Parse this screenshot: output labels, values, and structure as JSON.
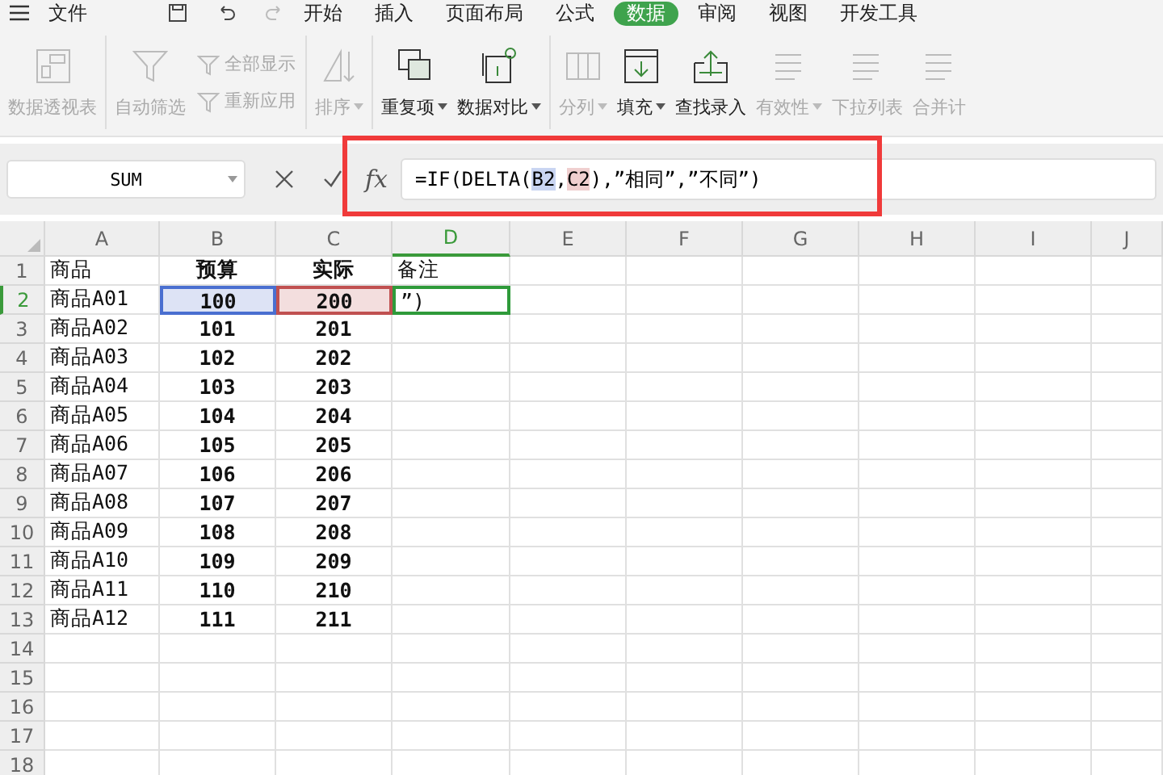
{
  "menu": {
    "file": "文件",
    "tabs": [
      {
        "label": "开始",
        "selected": false
      },
      {
        "label": "插入",
        "selected": false
      },
      {
        "label": "页面布局",
        "selected": false
      },
      {
        "label": "公式",
        "selected": false
      },
      {
        "label": "数据",
        "selected": true
      },
      {
        "label": "审阅",
        "selected": false
      },
      {
        "label": "视图",
        "selected": false
      },
      {
        "label": "开发工具",
        "selected": false
      }
    ]
  },
  "ribbon": {
    "groups": [
      [
        {
          "kind": "large",
          "label": "数据透视表",
          "disabled": true,
          "has_menu": false
        }
      ],
      [
        {
          "kind": "large",
          "label": "自动筛选",
          "disabled": true,
          "has_menu": false
        },
        {
          "kind": "stack",
          "items": [
            {
              "label": "全部显示",
              "disabled": true
            },
            {
              "label": "重新应用",
              "disabled": true
            }
          ]
        }
      ],
      [
        {
          "kind": "large",
          "label": "排序",
          "disabled": true,
          "has_menu": true
        }
      ],
      [
        {
          "kind": "large",
          "label": "重复项",
          "disabled": false,
          "has_menu": true
        },
        {
          "kind": "large",
          "label": "数据对比",
          "disabled": false,
          "has_menu": true
        }
      ],
      [
        {
          "kind": "large",
          "label": "分列",
          "disabled": true,
          "has_menu": true
        },
        {
          "kind": "large",
          "label": "填充",
          "disabled": false,
          "has_menu": true
        },
        {
          "kind": "large",
          "label": "查找录入",
          "disabled": false,
          "has_menu": false
        },
        {
          "kind": "large",
          "label": "有效性",
          "disabled": true,
          "has_menu": true
        },
        {
          "kind": "large",
          "label": "下拉列表",
          "disabled": true,
          "has_menu": false
        },
        {
          "kind": "large",
          "label": "合并计",
          "disabled": true,
          "has_menu": false
        }
      ]
    ]
  },
  "formula_bar": {
    "name_box": "SUM",
    "fx_label": "fx",
    "formula": [
      {
        "text": "=IF(DELTA("
      },
      {
        "text": "B2",
        "color": "#c9d5f2"
      },
      {
        "text": ","
      },
      {
        "text": "C2",
        "color": "#f0cfcf"
      },
      {
        "text": "),”相同”,”不同”)"
      }
    ],
    "highlighted": true
  },
  "sheet": {
    "columns": [
      {
        "label": "A",
        "selected": false
      },
      {
        "label": "B",
        "selected": false
      },
      {
        "label": "C",
        "selected": false
      },
      {
        "label": "D",
        "selected": true
      },
      {
        "label": "E",
        "selected": false
      },
      {
        "label": "F",
        "selected": false
      },
      {
        "label": "G",
        "selected": false
      },
      {
        "label": "H",
        "selected": false
      },
      {
        "label": "I",
        "selected": false
      },
      {
        "label": "J",
        "selected": false
      }
    ],
    "rows": [
      {
        "number": "1",
        "selected": false,
        "cells": [
          {
            "text": "商品",
            "bold": false,
            "centered": false,
            "active": false
          },
          {
            "text": "预算",
            "bold": true,
            "centered": true,
            "active": false
          },
          {
            "text": "实际",
            "bold": true,
            "centered": true,
            "active": false
          },
          {
            "text": "备注",
            "bold": false,
            "centered": false,
            "active": false
          }
        ]
      },
      {
        "number": "2",
        "selected": true,
        "cells": [
          {
            "text": "商品A01",
            "bold": false,
            "centered": false,
            "active": false
          },
          {
            "text": "100",
            "bold": true,
            "centered": true,
            "active": false,
            "color": "#dde3f5"
          },
          {
            "text": "200",
            "bold": true,
            "centered": true,
            "active": false,
            "color": "#f3dede"
          },
          {
            "text": "”)",
            "bold": false,
            "centered": false,
            "active": true
          }
        ]
      },
      {
        "number": "3",
        "selected": false,
        "cells": [
          {
            "text": "商品A02",
            "bold": false,
            "centered": false,
            "active": false
          },
          {
            "text": "101",
            "bold": true,
            "centered": true,
            "active": false
          },
          {
            "text": "201",
            "bold": true,
            "centered": true,
            "active": false
          }
        ]
      },
      {
        "number": "4",
        "selected": false,
        "cells": [
          {
            "text": "商品A03",
            "bold": false,
            "centered": false,
            "active": false
          },
          {
            "text": "102",
            "bold": true,
            "centered": true,
            "active": false
          },
          {
            "text": "202",
            "bold": true,
            "centered": true,
            "active": false
          }
        ]
      },
      {
        "number": "5",
        "selected": false,
        "cells": [
          {
            "text": "商品A04",
            "bold": false,
            "centered": false,
            "active": false
          },
          {
            "text": "103",
            "bold": true,
            "centered": true,
            "active": false
          },
          {
            "text": "203",
            "bold": true,
            "centered": true,
            "active": false
          }
        ]
      },
      {
        "number": "6",
        "selected": false,
        "cells": [
          {
            "text": "商品A05",
            "bold": false,
            "centered": false,
            "active": false
          },
          {
            "text": "104",
            "bold": true,
            "centered": true,
            "active": false
          },
          {
            "text": "204",
            "bold": true,
            "centered": true,
            "active": false
          }
        ]
      },
      {
        "number": "7",
        "selected": false,
        "cells": [
          {
            "text": "商品A06",
            "bold": false,
            "centered": false,
            "active": false
          },
          {
            "text": "105",
            "bold": true,
            "centered": true,
            "active": false
          },
          {
            "text": "205",
            "bold": true,
            "centered": true,
            "active": false
          }
        ]
      },
      {
        "number": "8",
        "selected": false,
        "cells": [
          {
            "text": "商品A07",
            "bold": false,
            "centered": false,
            "active": false
          },
          {
            "text": "106",
            "bold": true,
            "centered": true,
            "active": false
          },
          {
            "text": "206",
            "bold": true,
            "centered": true,
            "active": false
          }
        ]
      },
      {
        "number": "9",
        "selected": false,
        "cells": [
          {
            "text": "商品A08",
            "bold": false,
            "centered": false,
            "active": false
          },
          {
            "text": "107",
            "bold": true,
            "centered": true,
            "active": false
          },
          {
            "text": "207",
            "bold": true,
            "centered": true,
            "active": false
          }
        ]
      },
      {
        "number": "10",
        "selected": false,
        "cells": [
          {
            "text": "商品A09",
            "bold": false,
            "centered": false,
            "active": false
          },
          {
            "text": "108",
            "bold": true,
            "centered": true,
            "active": false
          },
          {
            "text": "208",
            "bold": true,
            "centered": true,
            "active": false
          }
        ]
      },
      {
        "number": "11",
        "selected": false,
        "cells": [
          {
            "text": "商品A10",
            "bold": false,
            "centered": false,
            "active": false
          },
          {
            "text": "109",
            "bold": true,
            "centered": true,
            "active": false
          },
          {
            "text": "209",
            "bold": true,
            "centered": true,
            "active": false
          }
        ]
      },
      {
        "number": "12",
        "selected": false,
        "cells": [
          {
            "text": "商品A11",
            "bold": false,
            "centered": false,
            "active": false
          },
          {
            "text": "110",
            "bold": true,
            "centered": true,
            "active": false
          },
          {
            "text": "210",
            "bold": true,
            "centered": true,
            "active": false
          }
        ]
      },
      {
        "number": "13",
        "selected": false,
        "cells": [
          {
            "text": "商品A12",
            "bold": false,
            "centered": false,
            "active": false
          },
          {
            "text": "111",
            "bold": true,
            "centered": true,
            "active": false
          },
          {
            "text": "211",
            "bold": true,
            "centered": true,
            "active": false
          }
        ]
      },
      {
        "number": "14",
        "selected": false,
        "cells": []
      },
      {
        "number": "15",
        "selected": false,
        "cells": []
      },
      {
        "number": "16",
        "selected": false,
        "cells": []
      },
      {
        "number": "17",
        "selected": false,
        "cells": []
      },
      {
        "number": "18",
        "selected": false,
        "cells": []
      }
    ]
  }
}
